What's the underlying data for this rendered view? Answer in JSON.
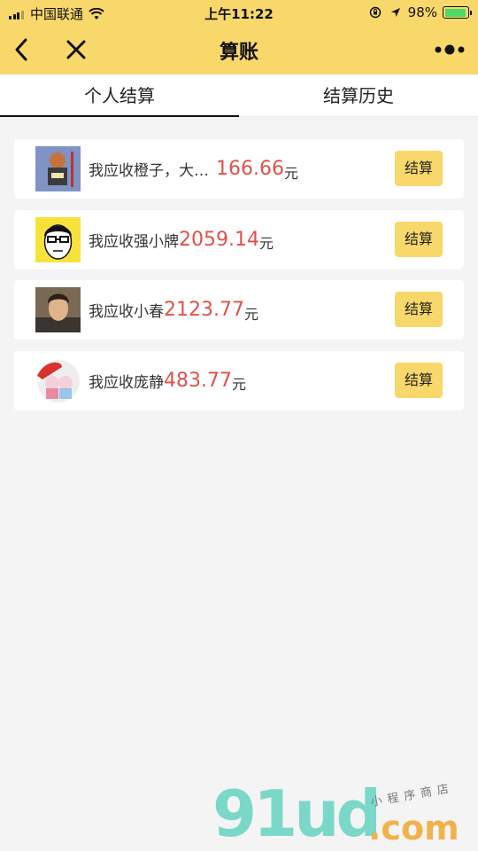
{
  "status_bar": {
    "carrier": "中国联通",
    "time": "上午11:22",
    "battery": "98%"
  },
  "nav": {
    "title": "算账"
  },
  "tabs": [
    {
      "label": "个人结算",
      "active": true
    },
    {
      "label": "结算历史",
      "active": false
    }
  ],
  "settlements": [
    {
      "label": "我应收橙子，大…",
      "amount": "166.66",
      "unit": "元",
      "button": "结算"
    },
    {
      "label": "我应收强小牌",
      "amount": "2059.14",
      "unit": "元",
      "button": "结算"
    },
    {
      "label": "我应收小春",
      "amount": "2123.77",
      "unit": "元",
      "button": "结算"
    },
    {
      "label": "我应收庞静",
      "amount": "483.77",
      "unit": "元",
      "button": "结算"
    }
  ],
  "watermark": {
    "logo": "91ud",
    "suffix": ".com",
    "tagline": "小程序商店"
  },
  "colors": {
    "brand_yellow": "#f8d86a",
    "amount_red": "#e0524a",
    "background": "#f4f4f4"
  },
  "icons": [
    "signal-icon",
    "wifi-icon",
    "orientation-lock-icon",
    "location-icon",
    "battery-icon",
    "back-arrow-icon",
    "close-icon",
    "more-dots-icon"
  ]
}
